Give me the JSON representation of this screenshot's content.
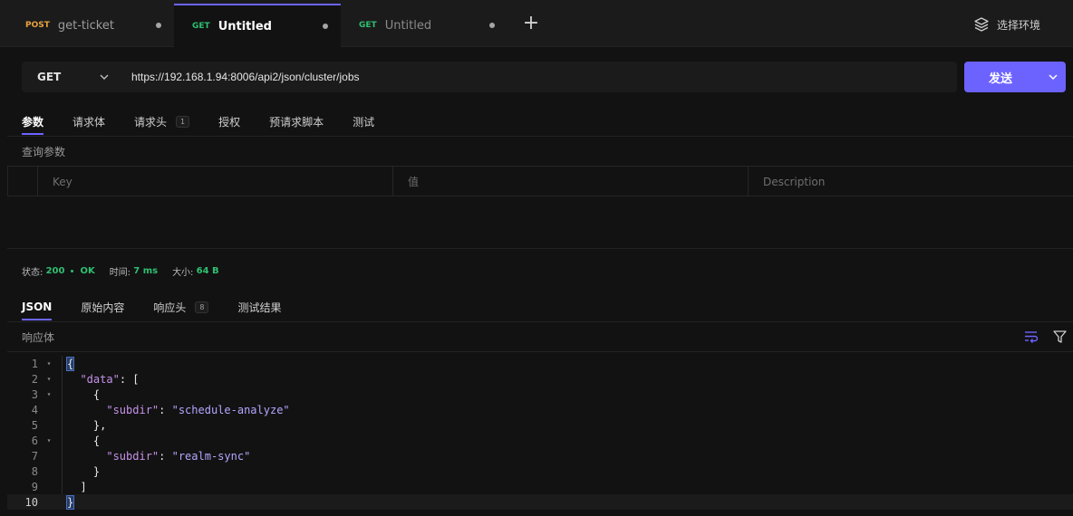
{
  "tabs": [
    {
      "method": "POST",
      "method_color": "#e8a33d",
      "name": "get-ticket",
      "active": false
    },
    {
      "method": "GET",
      "method_color": "#2fbf71",
      "name": "Untitled",
      "active": true
    },
    {
      "method": "GET",
      "method_color": "#2fbf71",
      "name": "Untitled",
      "active": false
    }
  ],
  "environment": {
    "label": "选择环境",
    "icon": "layers-icon"
  },
  "request": {
    "method": "GET",
    "url": "https://192.168.1.94:8006/api2/json/cluster/jobs",
    "send_label": "发送"
  },
  "request_tabs": [
    {
      "label": "参数",
      "active": true
    },
    {
      "label": "请求体"
    },
    {
      "label": "请求头",
      "count": "1"
    },
    {
      "label": "授权"
    },
    {
      "label": "预请求脚本"
    },
    {
      "label": "测试"
    }
  ],
  "query_params": {
    "title": "查询参数",
    "columns": [
      "Key",
      "值",
      "Description"
    ]
  },
  "status": {
    "status_label": "状态:",
    "code": "200",
    "text": "OK",
    "time_label": "时间:",
    "time": "7 ms",
    "size_label": "大小:",
    "size": "64 B"
  },
  "response_tabs": [
    {
      "label": "JSON",
      "active": true
    },
    {
      "label": "原始内容"
    },
    {
      "label": "响应头",
      "count": "8"
    },
    {
      "label": "测试结果"
    }
  ],
  "response_body": {
    "title": "响应体",
    "lines": [
      "1",
      "2",
      "3",
      "4",
      "5",
      "6",
      "7",
      "8",
      "9",
      "10"
    ],
    "json": {
      "data_key": "\"data\"",
      "subdir_key": "\"subdir\"",
      "value1": "\"schedule-analyze\"",
      "value2": "\"realm-sync\""
    }
  },
  "colors": {
    "accent": "#6c63ff",
    "ok": "#2fbf71",
    "post": "#e8a33d"
  }
}
